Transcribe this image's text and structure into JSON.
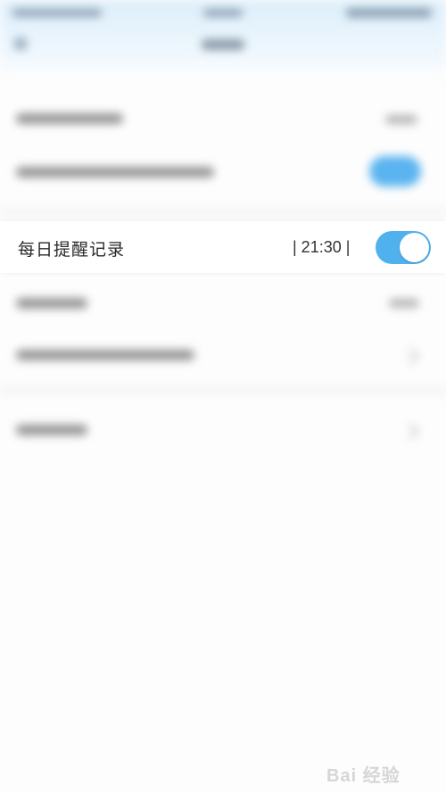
{
  "reminder_row": {
    "label": "每日提醒记录",
    "time": "| 21:30 |",
    "toggle_on": true
  },
  "colors": {
    "accent": "#4fb2ee",
    "header_bg": "#dceefa"
  },
  "watermark": {
    "text": "Bai  经验"
  }
}
